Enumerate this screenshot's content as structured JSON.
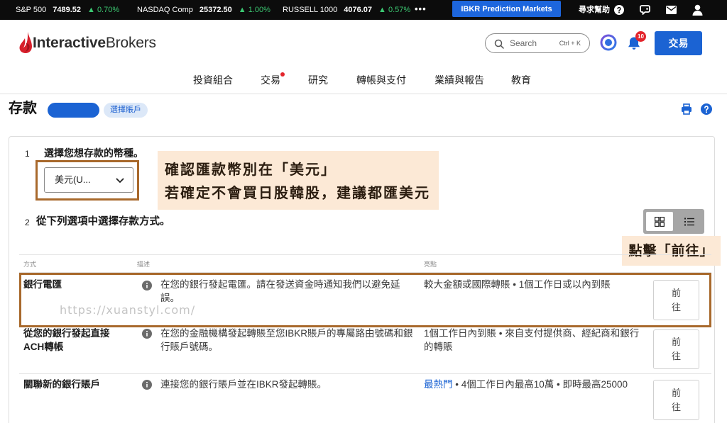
{
  "colors": {
    "accent": "#1b63d3",
    "positive": "#3cc872",
    "annotation_border": "#a8692c",
    "annotation_bg": "#fce9d6",
    "alert": "#e3242b"
  },
  "ticker": [
    {
      "name": "S&P 500",
      "value": "7489.52",
      "change": "▲ 0.70%"
    },
    {
      "name": "NASDAQ Comp",
      "value": "25372.50",
      "change": "▲ 1.00%"
    },
    {
      "name": "RUSSELL 1000",
      "value": "4076.07",
      "change": "▲ 0.57%"
    }
  ],
  "topbar": {
    "more_label": "•••",
    "prediction_button": "IBKR Prediction Markets",
    "help_label": "尋求幫助",
    "icons": [
      "question-circle-icon",
      "chat-icon",
      "mail-icon",
      "user-icon"
    ]
  },
  "header": {
    "logo": {
      "part1": "Interactive",
      "part2": "Brokers"
    },
    "search": {
      "placeholder": "Search",
      "shortcut": "Ctrl + K"
    },
    "notification_count": "10",
    "trade_button": "交易"
  },
  "nav": [
    {
      "label": "投資組合",
      "dot": false
    },
    {
      "label": "交易",
      "dot": true
    },
    {
      "label": "研究",
      "dot": false
    },
    {
      "label": "轉帳與支付",
      "dot": false
    },
    {
      "label": "業績與報告",
      "dot": false
    },
    {
      "label": "教育",
      "dot": false
    }
  ],
  "page": {
    "title": "存款",
    "select_account": "選擇賬戶"
  },
  "step1": {
    "number": "1",
    "label": "選擇您想存款的幣種。",
    "currency": {
      "value": "美元(U..."
    }
  },
  "step2": {
    "number": "2",
    "label": "從下列選項中選擇存款方式。"
  },
  "table": {
    "headers": {
      "method": "方式",
      "description": "描述",
      "highlights": "亮點"
    },
    "go_label": "前往",
    "rows": [
      {
        "method": "銀行電匯",
        "description": "在您的銀行發起電匯。請在發送資金時通知我們以避免延誤。",
        "highlight": "較大金額或國際轉賬 • 1個工作日或以內到賬"
      },
      {
        "method": "從您的銀行發起直接ACH轉帳",
        "description": "在您的金融機構發起轉賬至您IBKR賬戶的專屬路由號碼和銀行賬戶號碼。",
        "highlight": "1個工作日內到賬 • 來自支付提供商、經紀商和銀行的轉賬"
      },
      {
        "method": "關聯新的銀行賬戶",
        "description": "連接您的銀行賬戶並在IBKR發起轉賬。",
        "highlight_tag": "最熱門",
        "highlight": " • 4個工作日內最高10萬 • 即時最高25000"
      }
    ]
  },
  "annotations": {
    "currency_note": [
      "確認匯款幣別在「美元」",
      "若確定不會買日股韓股，建議都匯美元"
    ],
    "click_note": "點擊「前往」"
  },
  "watermark": "https://xuanstyl.com/"
}
